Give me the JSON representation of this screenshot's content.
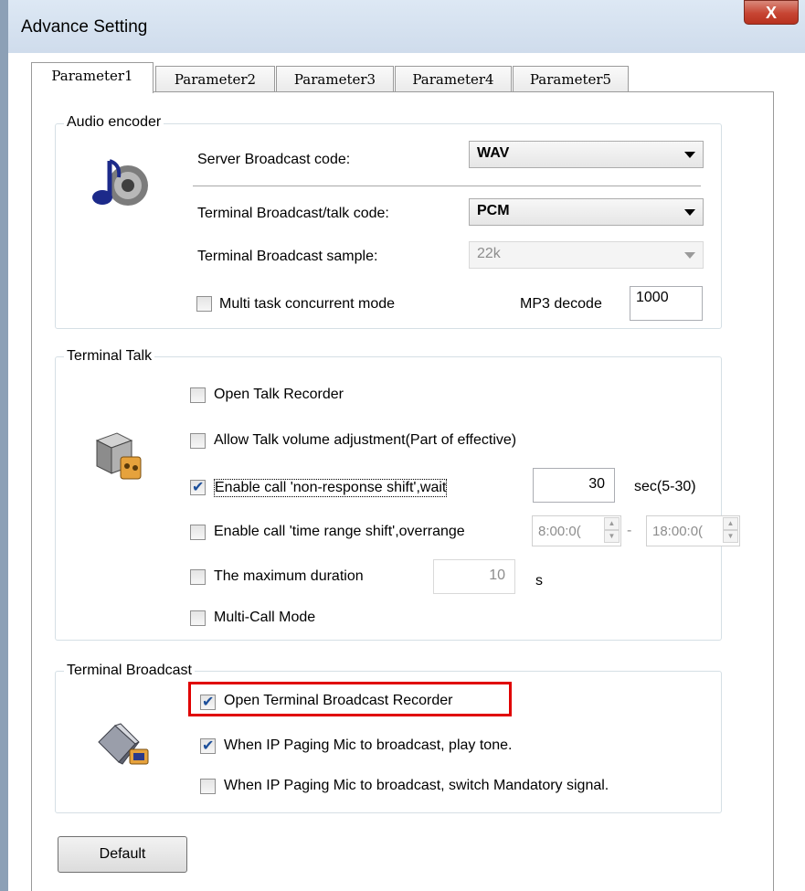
{
  "window": {
    "title": "Advance Setting",
    "close_glyph": "X"
  },
  "tabs": [
    {
      "label": "Parameter1",
      "active": true
    },
    {
      "label": "Parameter2",
      "active": false
    },
    {
      "label": "Parameter3",
      "active": false
    },
    {
      "label": "Parameter4",
      "active": false
    },
    {
      "label": "Parameter5",
      "active": false
    }
  ],
  "audio_encoder": {
    "group_label": "Audio encoder",
    "icon": "music-speaker-icon",
    "server_code": {
      "label": "Server Broadcast code:",
      "value": "WAV"
    },
    "terminal_code": {
      "label": "Terminal Broadcast/talk code:",
      "value": "PCM"
    },
    "terminal_sample": {
      "label": "Terminal Broadcast sample:",
      "value": "22k",
      "disabled": true
    },
    "multi_task": {
      "label": "Multi task concurrent mode",
      "checked": false
    },
    "mp3_decode": {
      "label": "MP3 decode",
      "value": "1000"
    }
  },
  "terminal_talk": {
    "group_label": "Terminal Talk",
    "icon": "talk-terminal-icon",
    "open_recorder": {
      "label": "Open Talk Recorder",
      "checked": false
    },
    "allow_volume": {
      "label": "Allow Talk volume adjustment(Part of effective)",
      "checked": false
    },
    "non_response": {
      "label": "Enable call 'non-response shift',wait",
      "checked": true,
      "value": "30",
      "unit": "sec(5-30)"
    },
    "time_range": {
      "label": "Enable call 'time range shift',overrange",
      "checked": false,
      "start": "8:00:0(",
      "separator": "-",
      "end": "18:00:0("
    },
    "max_duration": {
      "label": "The maximum duration",
      "checked": false,
      "value": "10",
      "unit": "s"
    },
    "multi_call": {
      "label": "Multi-Call Mode",
      "checked": false
    }
  },
  "terminal_broadcast": {
    "group_label": "Terminal Broadcast",
    "icon": "broadcast-terminal-icon",
    "open_recorder": {
      "label": "Open Terminal Broadcast Recorder",
      "checked": true
    },
    "play_tone": {
      "label": "When IP Paging Mic to broadcast, play tone.",
      "checked": true
    },
    "mandatory": {
      "label": "When IP Paging Mic to broadcast, switch Mandatory signal.",
      "checked": false
    }
  },
  "default_button": "Default",
  "colors": {
    "highlight": "#e00000",
    "check": "#1d4f9a",
    "close_button": "#c74533"
  }
}
